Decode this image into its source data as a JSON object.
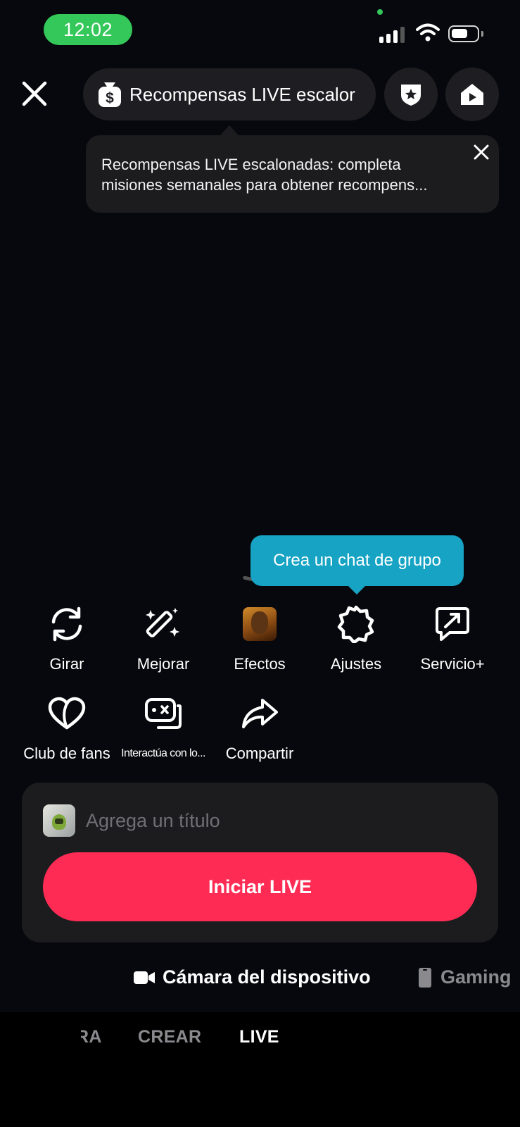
{
  "status_bar": {
    "time": "12:02",
    "accent_color": "#34c759"
  },
  "top_bar": {
    "close_icon": "close-icon",
    "rewards_pill_label": "Recompensas LIVE escalor",
    "rewards_icon": "dollar-bag-icon",
    "shield_icon": "shield-star-icon",
    "home_icon": "home-play-icon"
  },
  "rewards_tooltip": {
    "line1": "Recompensas LIVE escalonadas: completa",
    "line2": "misiones semanales para obtener recompens..."
  },
  "group_chat_tooltip": {
    "text": "Crea un chat de grupo",
    "color": "#16a3c4"
  },
  "tools": [
    {
      "label": "Girar",
      "icon": "rotate-icon"
    },
    {
      "label": "Mejorar",
      "icon": "magic-wand-icon"
    },
    {
      "label": "Efectos",
      "icon": "effects-thumbnail"
    },
    {
      "label": "Ajustes",
      "icon": "settings-gear-icon"
    },
    {
      "label": "Servicio+",
      "icon": "service-plus-icon"
    },
    {
      "label": "Club de fans",
      "icon": "heart-icon"
    },
    {
      "label": "Interactúa con lo...",
      "icon": "game-controller-icon"
    },
    {
      "label": "Compartir",
      "icon": "share-arrow-icon"
    }
  ],
  "title_card": {
    "placeholder": "Agrega un título",
    "start_button": "Iniciar LIVE",
    "button_color": "#fe2c55"
  },
  "sources": {
    "camera": "Cámara del dispositivo",
    "gaming": "Gaming"
  },
  "modes": {
    "partial": "RA",
    "create": "CREAR",
    "live": "LIVE",
    "selected": "LIVE"
  }
}
